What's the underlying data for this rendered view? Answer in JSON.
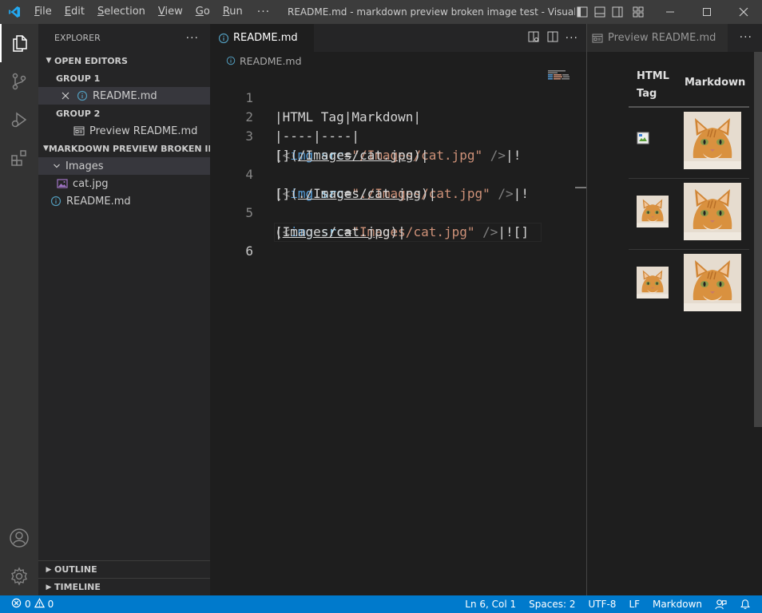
{
  "menu": {
    "items": [
      {
        "key": "F",
        "rest": "ile"
      },
      {
        "key": "E",
        "rest": "dit"
      },
      {
        "key": "S",
        "rest": "election"
      },
      {
        "key": "V",
        "rest": "iew"
      },
      {
        "key": "G",
        "rest": "o"
      },
      {
        "key": "R",
        "rest": "un"
      }
    ],
    "more": "···"
  },
  "window_title": "README.md - markdown preview broken image test - Visual Stud...",
  "explorer": {
    "title": "EXPLORER",
    "more": "···",
    "open_editors": "OPEN EDITORS",
    "group1": "GROUP 1",
    "group1_file": "README.md",
    "group2": "GROUP 2",
    "group2_file": "Preview README.md",
    "folder": "MARKDOWN PREVIEW BROKEN IM...",
    "images_folder": "Images",
    "cat_file": "cat.jpg",
    "readme_file": "README.md",
    "outline": "OUTLINE",
    "timeline": "TIMELINE"
  },
  "editor": {
    "tab_label": "README.md",
    "breadcrumb": "README.md",
    "line_numbers": [
      "1",
      "2",
      "3",
      "",
      "4",
      "",
      "5",
      "",
      "6"
    ],
    "line1": "|HTML Tag|Markdown|",
    "line2": "|----|----|",
    "pipe": "|",
    "lt": "<",
    "img": "img",
    "src": "src",
    "eq": "=",
    "close": " />",
    "bang": "!",
    "str1": "\"/Images/cat.jpg\"",
    "str2": "\"./Images/cat.jpg\"",
    "str3": "\"Images/cat.jpg\"",
    "wrap1_pre": "[](",
    "wrap1_link": "/Images/cat.jpg",
    "wrap2_link": "./Images/cat.jpg",
    "wrap3_pre": "(",
    "wrap3_link": "Images/cat.jpg",
    "post": ")|",
    "l5_tail": "![]"
  },
  "preview": {
    "tab_label": "Preview README.md",
    "more": "···",
    "col_html": "HTML Tag",
    "col_md": "Markdown"
  },
  "status": {
    "errors": "0",
    "warnings": "0",
    "position": "Ln 6, Col 1",
    "spaces": "Spaces: 2",
    "encoding": "UTF-8",
    "eol": "LF",
    "language": "Markdown"
  },
  "colors": {
    "accent": "#007acc",
    "tag": "#569cd6",
    "attr": "#9cdcfe",
    "string": "#ce9178"
  }
}
